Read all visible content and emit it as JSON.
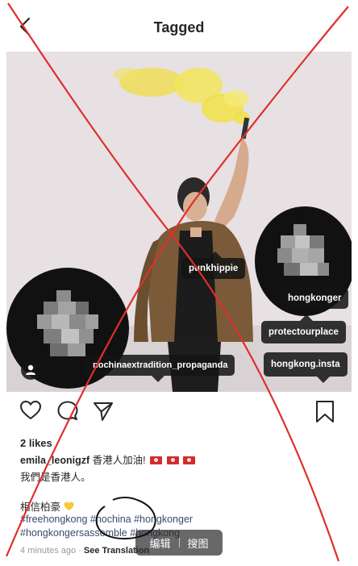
{
  "header": {
    "title": "Tagged",
    "back_icon": "chevron-left-icon"
  },
  "photo": {
    "tags": [
      {
        "label": "punkhippie"
      },
      {
        "label": "hongkonger"
      },
      {
        "label": "protectourplace"
      },
      {
        "label": "nochinaextradition_propaganda"
      },
      {
        "label": "hongkong.insta"
      }
    ],
    "smoke_color": "#f2e34a"
  },
  "actions": {
    "like_icon": "heart-icon",
    "comment_icon": "comment-icon",
    "share_icon": "send-icon",
    "save_icon": "bookmark-icon"
  },
  "post": {
    "likes": "2 likes",
    "username": "emila_leonigzf",
    "caption_text": "香港人加油!",
    "caption_line2": "我們是香港人。",
    "caption_line3": "相信柏豪",
    "hashtags_line1": "#freehongkong #nochina #hongkonger",
    "hashtags_line2": "#hongkongersassemble #hongkong",
    "time": "4 minutes ago",
    "separator": "·",
    "see_translation": "See Translation"
  },
  "watermark": {
    "left": "编辑",
    "right": "搜图"
  },
  "colors": {
    "annotation_red": "#e0302a",
    "text": "#262626",
    "hashtag": "#3a4a6e"
  }
}
